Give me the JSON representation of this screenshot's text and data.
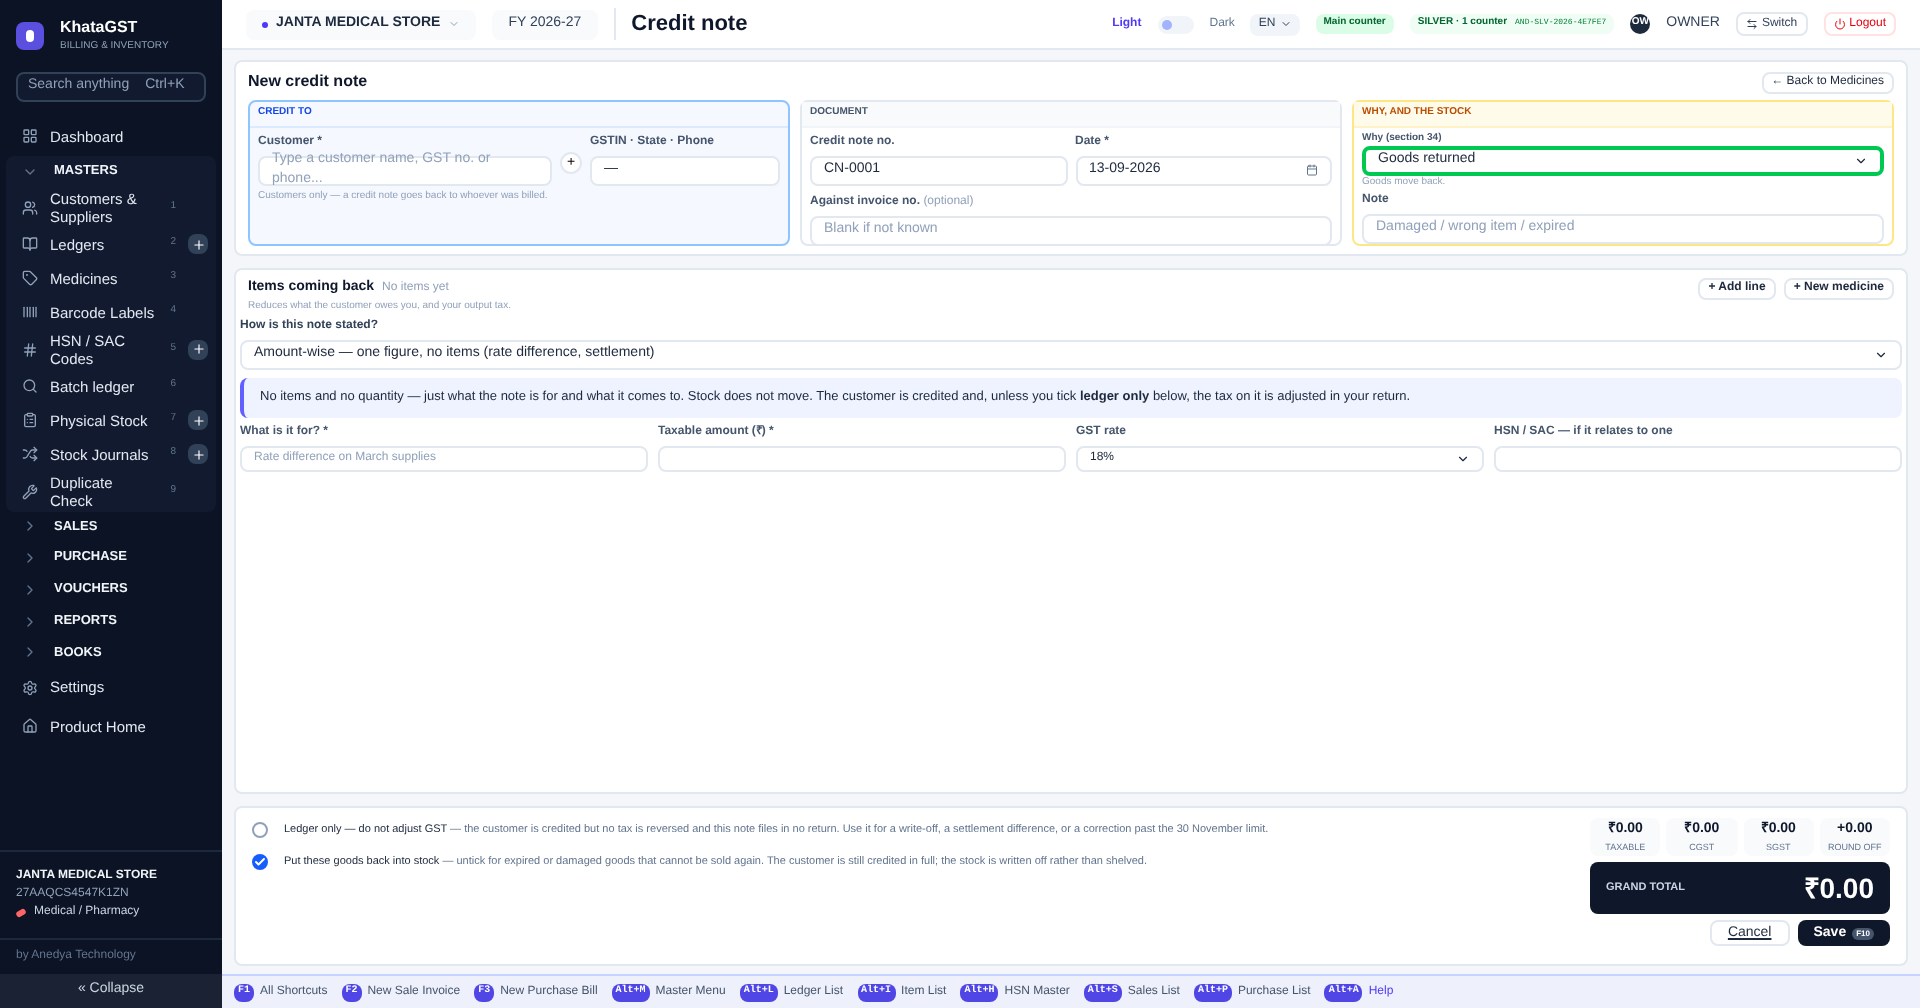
{
  "brand": {
    "name": "KhataGST",
    "tagline": "BILLING & INVENTORY"
  },
  "search": {
    "placeholder": "Search anything",
    "shortcut": "Ctrl+K"
  },
  "nav": [
    {
      "kind": "link",
      "label": "Dashboard"
    },
    {
      "kind": "group",
      "label": "MASTERS",
      "expanded": true,
      "children": [
        {
          "label": "Customers & Suppliers",
          "count": "1",
          "add": false
        },
        {
          "label": "Ledgers",
          "count": "2",
          "add": true
        },
        {
          "label": "Medicines",
          "count": "3",
          "add": false
        },
        {
          "label": "Barcode Labels",
          "count": "4",
          "add": false
        },
        {
          "label": "HSN / SAC Codes",
          "count": "5",
          "add": true
        },
        {
          "label": "Batch ledger",
          "count": "6",
          "add": false
        },
        {
          "label": "Physical Stock",
          "count": "7",
          "add": true
        },
        {
          "label": "Stock Journals",
          "count": "8",
          "add": true
        },
        {
          "label": "Duplicate Check",
          "count": "9",
          "add": false
        }
      ]
    },
    {
      "kind": "group",
      "label": "SALES",
      "expanded": false
    },
    {
      "kind": "group",
      "label": "PURCHASE",
      "expanded": false
    },
    {
      "kind": "group",
      "label": "VOUCHERS",
      "expanded": false
    },
    {
      "kind": "group",
      "label": "REPORTS",
      "expanded": false
    },
    {
      "kind": "group",
      "label": "BOOKS",
      "expanded": false
    },
    {
      "kind": "link",
      "label": "Settings"
    },
    {
      "kind": "link",
      "label": "Product Home"
    }
  ],
  "company": {
    "name": "JANTA MEDICAL STORE",
    "gstin": "27AAQCS4547K1ZN",
    "type": "Medical / Pharmacy",
    "vendor": "by Anedya Technology"
  },
  "collapse": "« Collapse",
  "topbar": {
    "store": "JANTA MEDICAL STORE",
    "fy": "FY 2026-27",
    "title": "Credit note",
    "theme_light": "Light",
    "theme_dark": "Dark",
    "dark_mode": false,
    "language": "EN",
    "counter": "Main counter",
    "plan": "SILVER · 1 counter",
    "license": "AND-SLV-2026-4E7FE7",
    "avatar": "OW",
    "role": "OWNER",
    "switch": "Switch",
    "logout": "Logout"
  },
  "form": {
    "heading": "New credit note",
    "back": "← Back to Medicines",
    "credit_to": {
      "title": "CREDIT TO",
      "customer_label": "Customer *",
      "customer_placeholder": "Type a customer name, GST no. or phone...",
      "add": "+",
      "hint": "Customers only — a credit note goes back to whoever was billed.",
      "gstin_label": "GSTIN · State · Phone",
      "gstin_value": "—"
    },
    "document": {
      "title": "DOCUMENT",
      "number_label": "Credit note no.",
      "number_value": "CN-0001",
      "date_label": "Date *",
      "date_value": "13-09-2026",
      "invoice_label": "Against invoice no.",
      "invoice_optional": "(optional)",
      "invoice_placeholder": "Blank if not known"
    },
    "why": {
      "title": "WHY, AND THE STOCK",
      "reason_label": "Why (section 34)",
      "reason_value": "Goods returned",
      "reason_hint": "Goods move back.",
      "note_label": "Note",
      "note_placeholder": "Damaged / wrong item / expired"
    }
  },
  "items": {
    "title": "Items coming back",
    "status": "No items yet",
    "subtitle": "Reduces what the customer owes you, and your output tax.",
    "add_line": "+ Add line",
    "new_medicine": "+ New medicine",
    "mode_label": "How is this note stated?",
    "mode_value": "Amount-wise — one figure, no items (rate difference, settlement)",
    "info": "No items and no quantity — just what the note is for and what it comes to. Stock does not move. The customer is credited and, unless you tick **ledger only** below, the tax on it is adjusted in your return.",
    "fields": [
      {
        "kind": "text",
        "label": "What is it for? *",
        "placeholder": "Rate difference on March supplies"
      },
      {
        "kind": "text",
        "label": "Taxable amount (₹) *"
      },
      {
        "kind": "select",
        "label": "GST rate",
        "value": "18%"
      },
      {
        "kind": "text",
        "label": "HSN / SAC — if it relates to one"
      }
    ]
  },
  "options": [
    {
      "checked": false,
      "title": "Ledger only — do not adjust GST",
      "text": " — the customer is credited but no tax is reversed and this note files in no return. Use it for a write-off, a settlement difference, or a correction past the 30 November limit."
    },
    {
      "checked": true,
      "title": "Put these goods back into stock",
      "text": " — untick for expired or damaged goods that cannot be sold again. The customer is still credited in full; the stock is written off rather than shelved."
    }
  ],
  "totals": [
    {
      "value": "₹0.00",
      "label": "TAXABLE"
    },
    {
      "value": "₹0.00",
      "label": "CGST"
    },
    {
      "value": "₹0.00",
      "label": "SGST"
    },
    {
      "value": "+0.00",
      "label": "ROUND OFF"
    }
  ],
  "grand_total": {
    "label": "GRAND TOTAL",
    "value": "₹0.00"
  },
  "actions": {
    "cancel": "Cancel",
    "save": "Save",
    "save_key": "F10"
  },
  "shortcuts": [
    {
      "key": "F1",
      "label": "All Shortcuts"
    },
    {
      "key": "F2",
      "label": "New Sale Invoice"
    },
    {
      "key": "F3",
      "label": "New Purchase Bill"
    },
    {
      "key": "Alt+M",
      "label": "Master Menu"
    },
    {
      "key": "Alt+L",
      "label": "Ledger List"
    },
    {
      "key": "Alt+I",
      "label": "Item List"
    },
    {
      "key": "Alt+H",
      "label": "HSN Master"
    },
    {
      "key": "Alt+S",
      "label": "Sales List"
    },
    {
      "key": "Alt+P",
      "label": "Purchase List"
    },
    {
      "key": "Alt+A",
      "label": "Help"
    }
  ]
}
